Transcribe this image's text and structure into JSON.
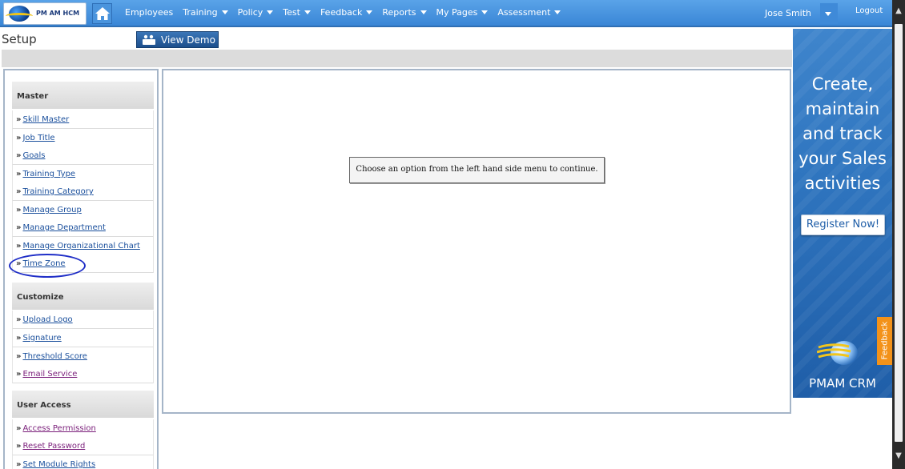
{
  "header": {
    "logo_text": "PM AM HCM",
    "nav": [
      "Employees",
      "Training",
      "Policy",
      "Test",
      "Feedback",
      "Reports",
      "My Pages",
      "Assessment"
    ],
    "user_name": "Jose Smith",
    "logout_label": "Logout"
  },
  "page": {
    "title": "Setup",
    "demo_button": "View Demo"
  },
  "sidebar": {
    "sections": [
      {
        "title": "Master",
        "items": [
          "Skill Master",
          "Job Title",
          "Goals",
          "Training Type",
          "Training Category",
          "Manage Group",
          "Manage Department",
          "Manage Organizational Chart",
          "Time Zone"
        ]
      },
      {
        "title": "Customize",
        "items": [
          "Upload Logo",
          "Signature",
          "Threshold Score",
          "Email Service"
        ]
      },
      {
        "title": "User Access",
        "items": [
          "Access Permission",
          "Reset Password",
          "Set Module Rights"
        ]
      }
    ],
    "highlighted_item": "Time Zone"
  },
  "main": {
    "message": "Choose an option from the left hand side menu to continue."
  },
  "ad": {
    "headline": [
      "Create,",
      "maintain",
      "and track",
      "your Sales",
      "activities"
    ],
    "register_button": "Register Now!",
    "feedback_tab": "Feedback",
    "brand": "PMAM CRM"
  },
  "colors": {
    "nav_bg": "#3a86d6",
    "link": "#1a4f9c",
    "visited_link": "#7a1e7a",
    "highlight_ring": "#1f2ec7",
    "ad_bg": "#2f75bf",
    "feedback_tab": "#f39219"
  }
}
